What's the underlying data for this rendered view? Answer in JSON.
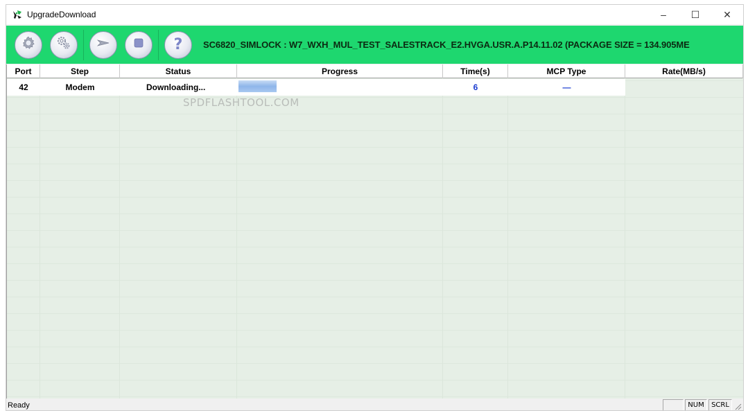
{
  "window": {
    "title": "UpgradeDownload",
    "controls": {
      "minimize": "–",
      "maximize": "☐",
      "close": "✕"
    }
  },
  "toolbar": {
    "buttons": [
      {
        "name": "load-packet",
        "icon": "gear-icon"
      },
      {
        "name": "settings",
        "icon": "gears-icon"
      },
      {
        "name": "start-download",
        "icon": "play-icon"
      },
      {
        "name": "stop-download",
        "icon": "stop-icon"
      },
      {
        "name": "help",
        "icon": "help-icon",
        "glyph": "?"
      }
    ],
    "package_info": "SC6820_SIMLOCK : W7_WXH_MUL_TEST_SALESTRACK_E2.HVGA.USR.A.P14.11.02 (PACKAGE SIZE = 134.905ME"
  },
  "table": {
    "columns": [
      "Port",
      "Step",
      "Status",
      "Progress",
      "Time(s)",
      "MCP Type",
      "Rate(MB/s)"
    ],
    "rows": [
      {
        "port": "42",
        "step": "Modem",
        "status": "Downloading...",
        "progress": 0.19,
        "time": "6",
        "mcp_type": "—",
        "rate": ""
      }
    ]
  },
  "watermark": "SPDFLASHTOOL.COM",
  "statusbar": {
    "text": "Ready",
    "indicators": [
      "",
      "NUM",
      "SCRL"
    ]
  },
  "colors": {
    "toolbar_bg": "#1ed76f",
    "grid_bg": "#e6efe6",
    "progress_fill": "#8fb6ea",
    "value_blue": "#1a3bd0"
  }
}
